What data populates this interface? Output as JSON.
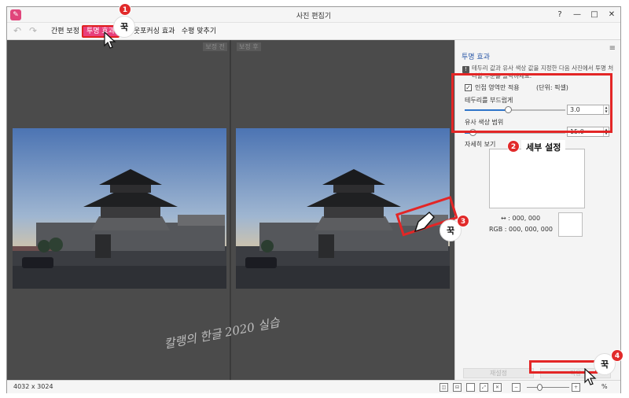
{
  "window": {
    "title": "사진 편집기",
    "help": "?",
    "minimize": "—",
    "maximize": "□",
    "close": "✕"
  },
  "toolbar": {
    "undo_icon": "↶",
    "redo_icon": "↷",
    "tabs": [
      {
        "label": "간편 보정",
        "active": false
      },
      {
        "label": "투명 효과",
        "active": true
      },
      {
        "label": "아웃포커싱 효과",
        "active": false
      },
      {
        "label": "수평 맞추기",
        "active": false
      }
    ]
  },
  "viewer": {
    "before_label": "보정 전",
    "after_label": "보정 후",
    "watermark": "칼랭의 한글 2020 실습"
  },
  "panel": {
    "title": "투명 효과",
    "menu_icon": "≡",
    "help_text": "테두리 값과 유사 색상 값을 지정한 다음 사진에서 투명 처리할 부분을 클릭하세요.",
    "adjacent_only_label": "인접 영역만 적용",
    "adjacent_only_checked": true,
    "unit_label": "(단위: 픽셀)",
    "edge_softness_label": "테두리를 부드럽게",
    "edge_softness_value": "3.0",
    "edge_softness_fraction": 0.43,
    "color_range_label": "유사 색상 범위",
    "color_range_value": "15.0",
    "color_range_fraction": 0.08,
    "detail_label": "자세히 보기",
    "coord_label": "↔ : 000, 000",
    "rgb_label": "RGB : 000, 000, 000",
    "reset_button": "재설정",
    "apply_button": "적용"
  },
  "status": {
    "image_size": "4032 x 3024",
    "zoom_text": "%"
  },
  "annotations": {
    "badges": [
      "1",
      "2",
      "3",
      "4"
    ],
    "callout_text": "꾹",
    "detail_settings_label": "세부 설정"
  },
  "colors": {
    "accent_pink": "#e8407c",
    "annotation_red": "#e32626",
    "panel_title_blue": "#2d5aa8",
    "viewer_bg": "#4b4b4b"
  }
}
